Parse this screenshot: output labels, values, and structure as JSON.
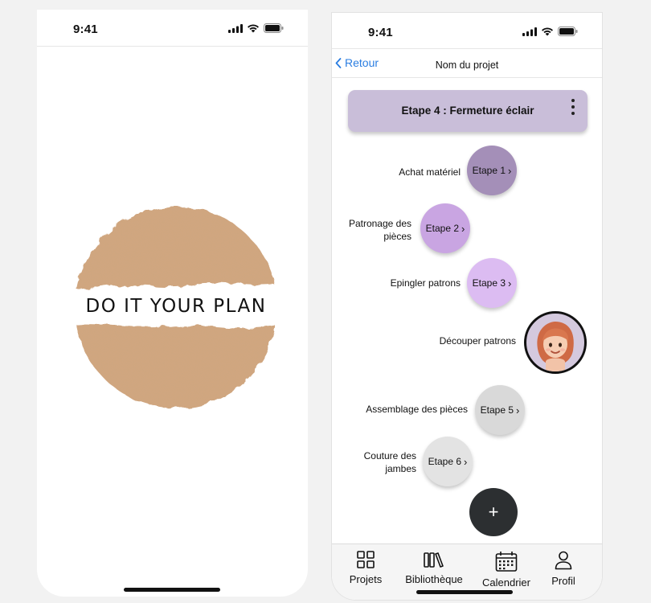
{
  "splash": {
    "status_time": "9:41",
    "logo_text": "DO IT YOUR PLAN"
  },
  "project": {
    "status_time": "9:41",
    "nav": {
      "back_label": "Retour",
      "title": "Nom du projet"
    },
    "current_step": {
      "title": "Etape 4 : Fermeture éclair",
      "color": "#c9bed9"
    },
    "steps": [
      {
        "label": "Achat matériel",
        "button": "Etape 1",
        "color": "#a48fb8"
      },
      {
        "label": "Patronage des pièces",
        "button": "Etape 2",
        "color": "#c9a5e2"
      },
      {
        "label": "Epingler patrons",
        "button": "Etape 3",
        "color": "#dcbcf2"
      },
      {
        "label": "Découper patrons",
        "button": "",
        "color": "#d4c9de"
      },
      {
        "label": "Assemblage des pièces",
        "button": "Etape 5",
        "color": "#d9d9d9"
      },
      {
        "label": "Couture des jambes",
        "button": "Etape 6",
        "color": "#e3e3e3"
      }
    ],
    "fab_symbol": "+",
    "tabs": [
      {
        "label": "Projets",
        "icon": "grid-icon"
      },
      {
        "label": "Bibliothèque",
        "icon": "books-icon"
      },
      {
        "label": "Calendrier",
        "icon": "calendar-icon"
      },
      {
        "label": "Profil",
        "icon": "user-icon"
      }
    ]
  }
}
